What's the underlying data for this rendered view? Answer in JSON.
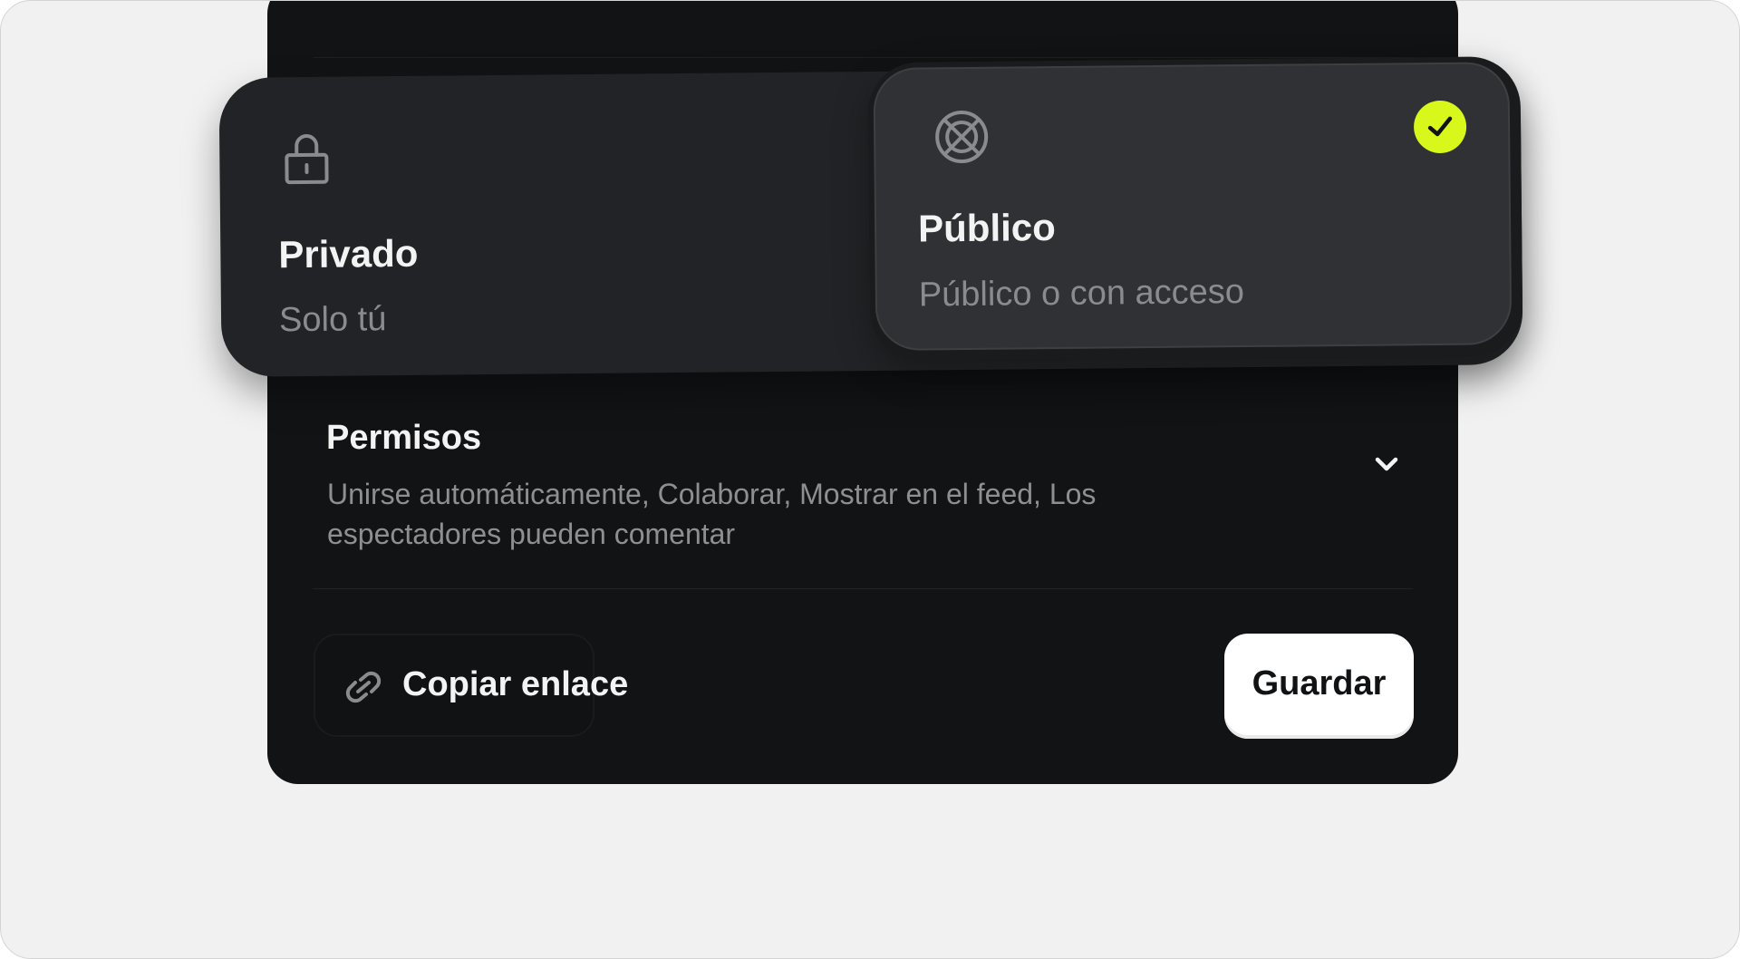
{
  "visibility": {
    "selected": "public",
    "accent_color": "#d8f81c",
    "options": [
      {
        "id": "private",
        "icon": "lock-icon",
        "title": "Privado",
        "subtitle": "Solo tú"
      },
      {
        "id": "public",
        "icon": "globe-off-icon",
        "title": "Público",
        "subtitle": "Público o con acceso"
      }
    ]
  },
  "permissions": {
    "title": "Permisos",
    "description": "Unirse automáticamente, Colaborar, Mostrar en el feed, Los espectadores pueden comentar",
    "toggle_icon": "chevron-down-icon"
  },
  "footer": {
    "copy_link_label": "Copiar enlace",
    "copy_link_icon": "link-icon",
    "save_label": "Guardar"
  },
  "colors": {
    "dialog_background": "#121315",
    "page_background": "#f1f1f1",
    "save_button_background": "#ffffff"
  }
}
